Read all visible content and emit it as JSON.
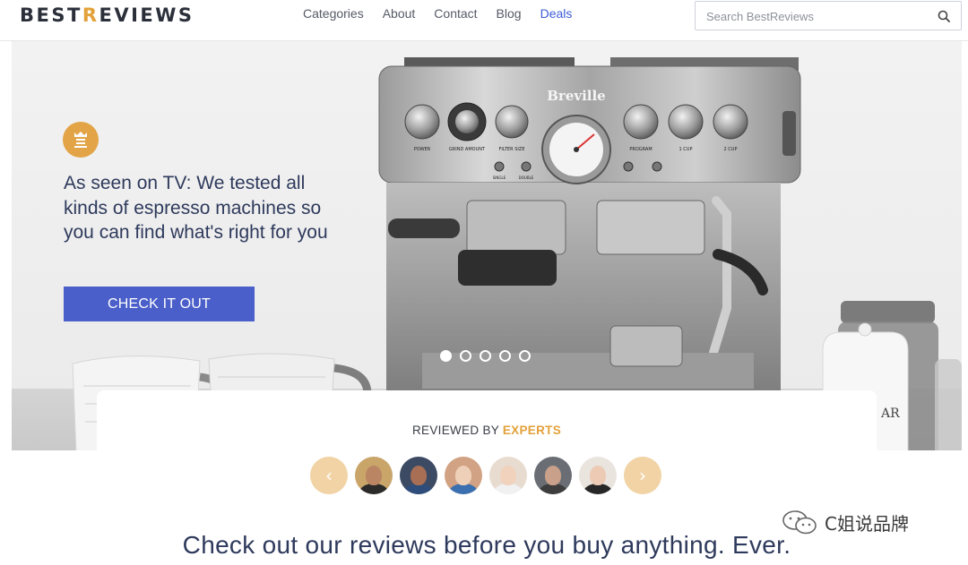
{
  "header": {
    "logo_text_left": "BEST",
    "logo_crown_letter": "R",
    "logo_text_right": "EVIEWS",
    "nav": [
      {
        "label": "Categories"
      },
      {
        "label": "About"
      },
      {
        "label": "Contact"
      },
      {
        "label": "Blog"
      },
      {
        "label": "Deals"
      }
    ],
    "search": {
      "placeholder": "Search BestReviews",
      "icon": "search-icon"
    }
  },
  "hero": {
    "badge_icon": "bestreviews-crown-icon",
    "title": "As seen on TV: We tested all kinds of espresso machines so you can find what's right for you",
    "cta_label": "CHECK IT OUT",
    "machine_brand": "Breville",
    "machine_labels": {
      "power": "POWER",
      "grind": "GRIND AMOUNT",
      "filter": "FILTER SIZE",
      "program": "PROGRAM",
      "single": "SINGLE",
      "double": "DOUBLE",
      "one_cup": "1 CUP",
      "two_cup": "2 CUP"
    },
    "slides_total": 5,
    "active_slide": 1
  },
  "experts": {
    "title_prefix": "REVIEWED BY ",
    "title_highlight": "EXPERTS",
    "prev_icon": "chevron-left-icon",
    "next_icon": "chevron-right-icon",
    "avatars": [
      {
        "name": "expert-1",
        "bg": "#c9a56a",
        "skin": "#b98562",
        "shirt": "#2b2b2b"
      },
      {
        "name": "expert-2",
        "bg": "#3c4a63",
        "skin": "#a86f55",
        "shirt": "#2f4d7a"
      },
      {
        "name": "expert-3",
        "bg": "#d1a283",
        "skin": "#eed0b8",
        "shirt": "#3a6fb0"
      },
      {
        "name": "expert-4",
        "bg": "#e8dcd0",
        "skin": "#f0d2bd",
        "shirt": "#f1f1f1"
      },
      {
        "name": "expert-5",
        "bg": "#6a6e74",
        "skin": "#c9a08a",
        "shirt": "#3d3d3d"
      },
      {
        "name": "expert-6",
        "bg": "#e9e4de",
        "skin": "#eccab4",
        "shirt": "#272727"
      }
    ]
  },
  "tagline": "Check out our reviews before you buy anything. Ever.",
  "watermark": {
    "text": "C姐说品牌",
    "icon": "wechat-icon"
  },
  "colors": {
    "accent": "#e3a13a",
    "primary": "#4a5fc9",
    "navy": "#2e3a5c"
  }
}
